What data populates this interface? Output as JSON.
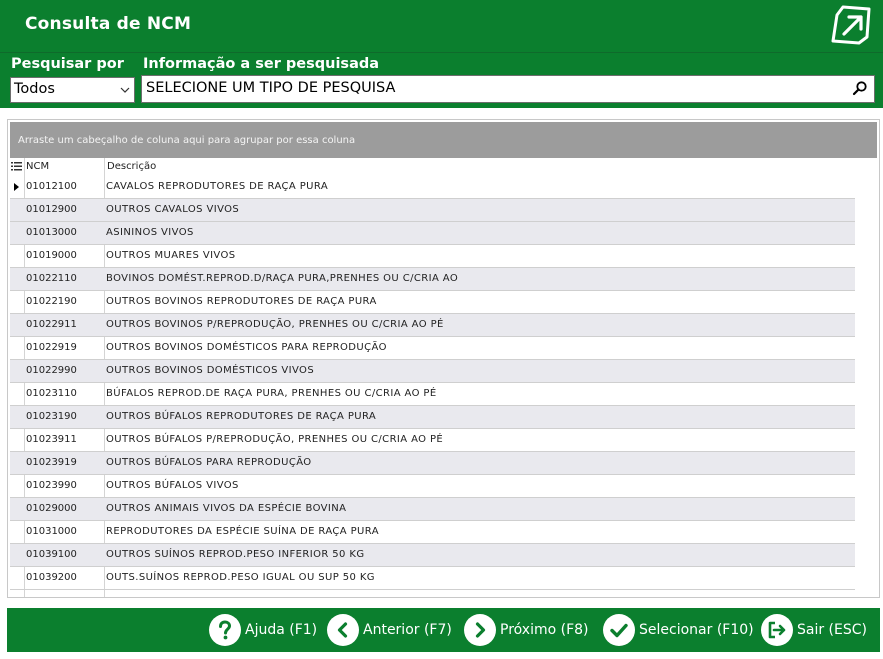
{
  "window": {
    "title": "Consulta de NCM"
  },
  "search": {
    "by_label": "Pesquisar por",
    "by_value": "Todos",
    "info_label": "Informação a ser pesquisada",
    "info_value": "SELECIONE UM TIPO DE PESQUISA"
  },
  "grid": {
    "group_hint": "Arraste um cabeçalho de coluna aqui para agrupar por essa coluna",
    "columns": {
      "ncm": "NCM",
      "descricao": "Descrição"
    },
    "rows": [
      {
        "ncm": "01012100",
        "desc": "CAVALOS REPRODUTORES DE RAÇA PURA"
      },
      {
        "ncm": "01012900",
        "desc": "OUTROS CAVALOS VIVOS"
      },
      {
        "ncm": "01013000",
        "desc": "ASININOS VIVOS"
      },
      {
        "ncm": "01019000",
        "desc": "OUTROS MUARES VIVOS"
      },
      {
        "ncm": "01022110",
        "desc": "BOVINOS DOMÉST.REPROD.D/RAÇA PURA,PRENHES OU C/CRIA AO"
      },
      {
        "ncm": "01022190",
        "desc": "OUTROS BOVINOS REPRODUTORES DE RAÇA PURA"
      },
      {
        "ncm": "01022911",
        "desc": "OUTROS BOVINOS P/REPRODUÇÃO, PRENHES OU C/CRIA AO PÉ"
      },
      {
        "ncm": "01022919",
        "desc": "OUTROS BOVINOS DOMÉSTICOS PARA REPRODUÇÃO"
      },
      {
        "ncm": "01022990",
        "desc": "OUTROS BOVINOS DOMÉSTICOS VIVOS"
      },
      {
        "ncm": "01023110",
        "desc": "BÚFALOS REPROD.DE RAÇA PURA, PRENHES OU C/CRIA AO PÉ"
      },
      {
        "ncm": "01023190",
        "desc": "OUTROS BÚFALOS REPRODUTORES DE RAÇA PURA"
      },
      {
        "ncm": "01023911",
        "desc": "OUTROS BÚFALOS P/REPRODUÇÃO, PRENHES OU C/CRIA AO PÉ"
      },
      {
        "ncm": "01023919",
        "desc": "OUTROS BÚFALOS PARA REPRODUÇÃO"
      },
      {
        "ncm": "01023990",
        "desc": "OUTROS BÚFALOS VIVOS"
      },
      {
        "ncm": "01029000",
        "desc": "OUTROS ANIMAIS VIVOS DA ESPÉCIE BOVINA"
      },
      {
        "ncm": "01031000",
        "desc": "REPRODUTORES DA ESPÉCIE SUÍNA DE RAÇA PURA"
      },
      {
        "ncm": "01039100",
        "desc": "OUTROS SUÍNOS REPROD.PESO INFERIOR 50 KG"
      },
      {
        "ncm": "01039200",
        "desc": "OUTS.SUÍNOS REPROD.PESO IGUAL OU SUP 50 KG"
      }
    ]
  },
  "footer": {
    "help": "Ajuda (F1)",
    "prev": "Anterior (F7)",
    "next": "Próximo (F8)",
    "select": "Selecionar (F10)",
    "exit": "Sair (ESC)"
  },
  "colors": {
    "brand": "#0b7f2e",
    "group_panel": "#9c9c9c",
    "alt_row": "#e9e9ee"
  },
  "icons": [
    "exit-arrow-icon",
    "chevron-down-icon",
    "search-icon",
    "column-menu-icon",
    "help-icon",
    "arrow-left-icon",
    "arrow-right-icon",
    "check-icon",
    "exit-door-icon"
  ]
}
